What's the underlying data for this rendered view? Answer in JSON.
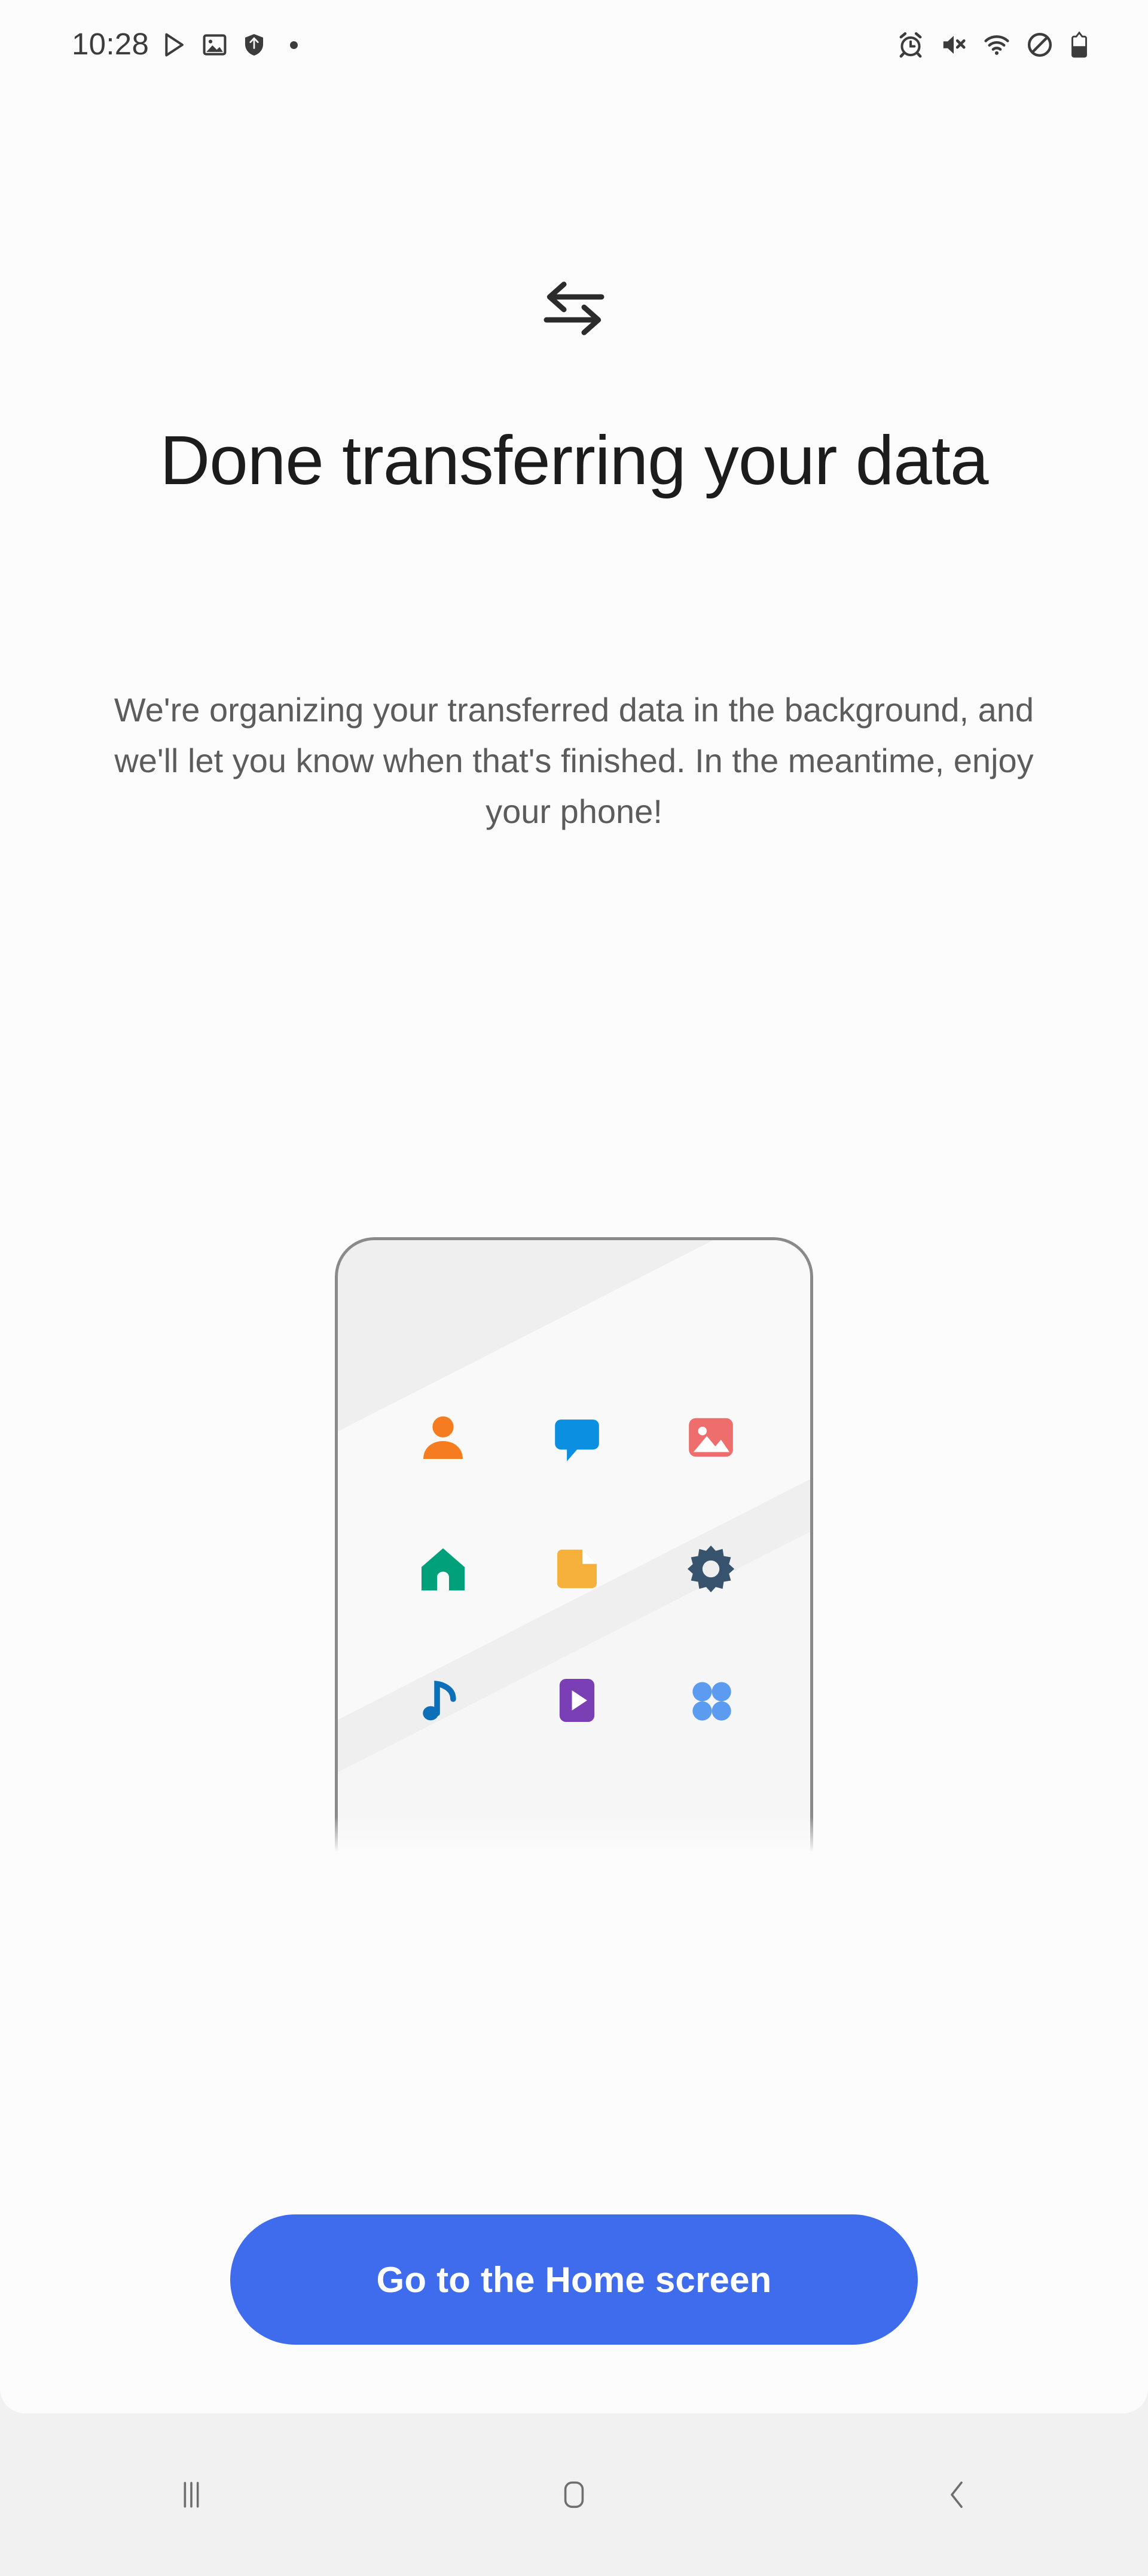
{
  "status_bar": {
    "time": "10:28",
    "left_icons": [
      {
        "name": "play-store-icon"
      },
      {
        "name": "gallery-notification-icon"
      },
      {
        "name": "shield-icon"
      },
      {
        "name": "notification-dot-icon"
      }
    ],
    "right_icons": [
      {
        "name": "alarm-icon"
      },
      {
        "name": "mute-icon"
      },
      {
        "name": "wifi-icon"
      },
      {
        "name": "do-not-disturb-icon"
      },
      {
        "name": "battery-icon"
      }
    ]
  },
  "header": {
    "icon": "transfer-arrows-icon",
    "title": "Done transferring your data",
    "subtitle": "We're organizing your transferred data in the background, and we'll let you know when that's finished. In the meantime, enjoy your phone!"
  },
  "illustration": {
    "name": "phone-with-apps-illustration",
    "apps": [
      {
        "name": "contacts-icon",
        "color": "#F57C20"
      },
      {
        "name": "messages-icon",
        "color": "#0B8FE0"
      },
      {
        "name": "gallery-icon",
        "color": "#EE6E6E"
      },
      {
        "name": "home-icon",
        "color": "#00A07B"
      },
      {
        "name": "document-icon",
        "color": "#F5B13C"
      },
      {
        "name": "settings-icon",
        "color": "#37536D"
      },
      {
        "name": "music-icon",
        "color": "#0D6FB8"
      },
      {
        "name": "video-icon",
        "color": "#7A3FB5"
      },
      {
        "name": "apps-grid-icon",
        "color": "#5B9BF0"
      }
    ]
  },
  "footer": {
    "primary_button": "Go to the Home screen",
    "primary_button_color": "#3F6CED"
  },
  "nav_bar": {
    "buttons": [
      {
        "name": "recents-button"
      },
      {
        "name": "home-button"
      },
      {
        "name": "back-button"
      }
    ]
  }
}
